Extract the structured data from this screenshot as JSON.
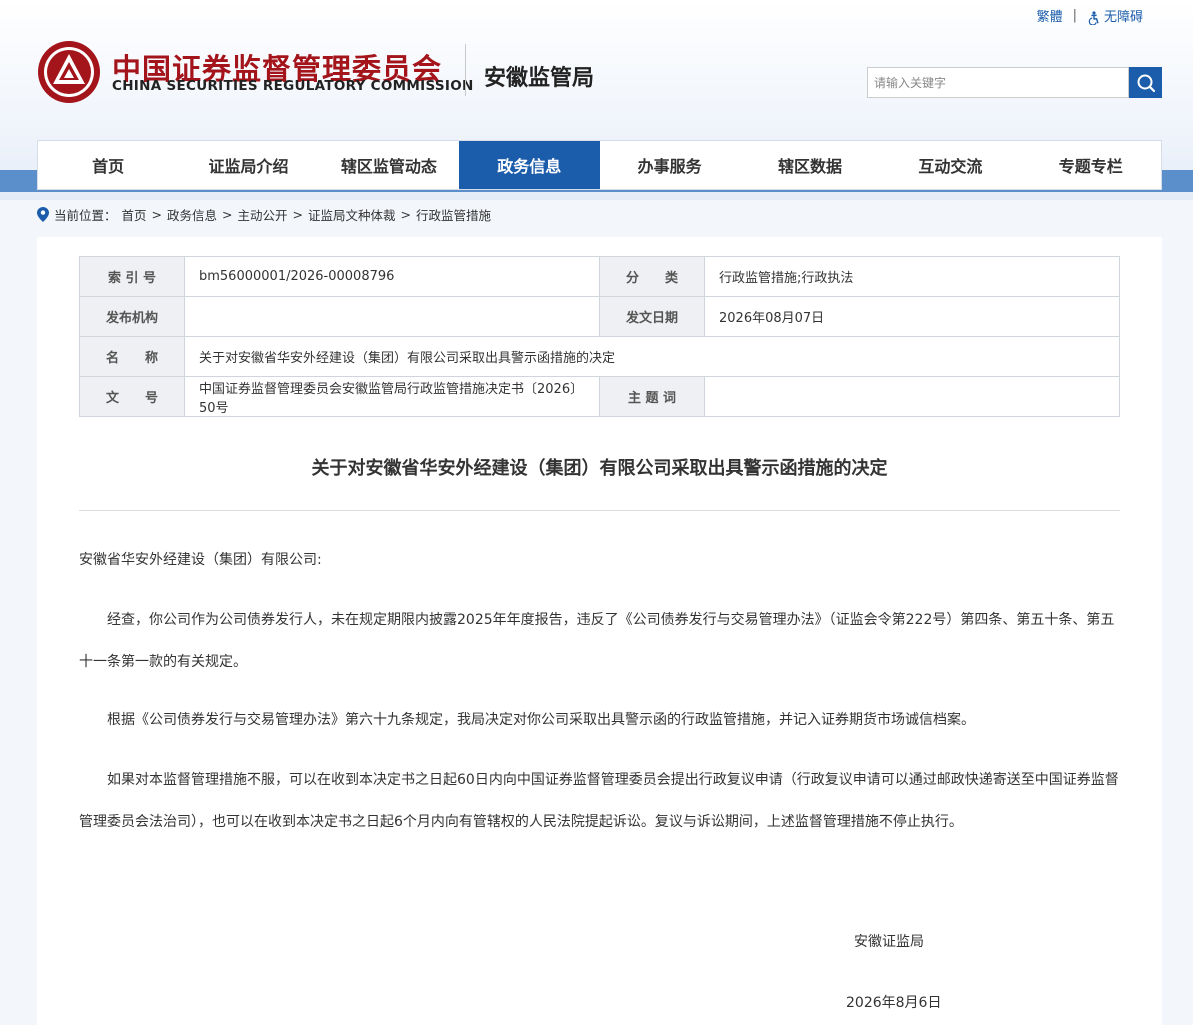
{
  "top_links": {
    "traditional": "繁體",
    "separator": "|",
    "accessibility": "无障碍"
  },
  "header": {
    "title_cn": "中国证券监督管理委员会",
    "title_en": "CHINA SECURITIES REGULATORY COMMISSION",
    "bureau": "安徽监管局",
    "search_placeholder": "请输入关键字"
  },
  "nav": [
    {
      "label": "首页"
    },
    {
      "label": "证监局介绍"
    },
    {
      "label": "辖区监管动态"
    },
    {
      "label": "政务信息",
      "active": true
    },
    {
      "label": "办事服务"
    },
    {
      "label": "辖区数据"
    },
    {
      "label": "互动交流"
    },
    {
      "label": "专题专栏"
    }
  ],
  "breadcrumb": {
    "prefix": "当前位置：",
    "items": [
      "首页",
      "政务信息",
      "主动公开",
      "证监局文种体裁",
      "行政监管措施"
    ],
    "sep": ">"
  },
  "meta": {
    "index_label": "索 引 号",
    "index_value": "bm56000001/2026-00008796",
    "category_label": "分　　类",
    "category_value": "行政监管措施;行政执法",
    "publisher_label": "发布机构",
    "publisher_value": "",
    "date_label": "发文日期",
    "date_value": "2026年08月07日",
    "name_label": "名　　称",
    "name_value": "关于对安徽省华安外经建设（集团）有限公司采取出具警示函措施的决定",
    "docno_label": "文　　号",
    "docno_value": "中国证券监督管理委员会安徽监管局行政监管措施决定书〔2026〕50号",
    "keyword_label": "主 题 词",
    "keyword_value": ""
  },
  "document": {
    "title": "关于对安徽省华安外经建设（集团）有限公司采取出具警示函措施的决定",
    "salutation": "安徽省华安外经建设（集团）有限公司:",
    "p1": "　　经查，你公司作为公司债券发行人，未在规定期限内披露2025年年度报告，违反了《公司债券发行与交易管理办法》（证监会令第222号）第四条、第五十条、第五十一条第一款的有关规定。",
    "p2": "　　根据《公司债券发行与交易管理办法》第六十九条规定，我局决定对你公司采取出具警示函的行政监管措施，并记入证券期货市场诚信档案。",
    "p3": "　　如果对本监督管理措施不服，可以在收到本决定书之日起60日内向中国证券监督管理委员会提出行政复议申请（行政复议申请可以通过邮政快递寄送至中国证券监督管理委员会法治司），也可以在收到本决定书之日起6个月内向有管辖权的人民法院提起诉讼。复议与诉讼期间，上述监督管理措施不停止执行。",
    "signature": "安徽证监局",
    "sign_date": "2026年8月6日"
  },
  "colors": {
    "brand_blue": "#1c5dab",
    "brand_red": "#a3141b"
  }
}
